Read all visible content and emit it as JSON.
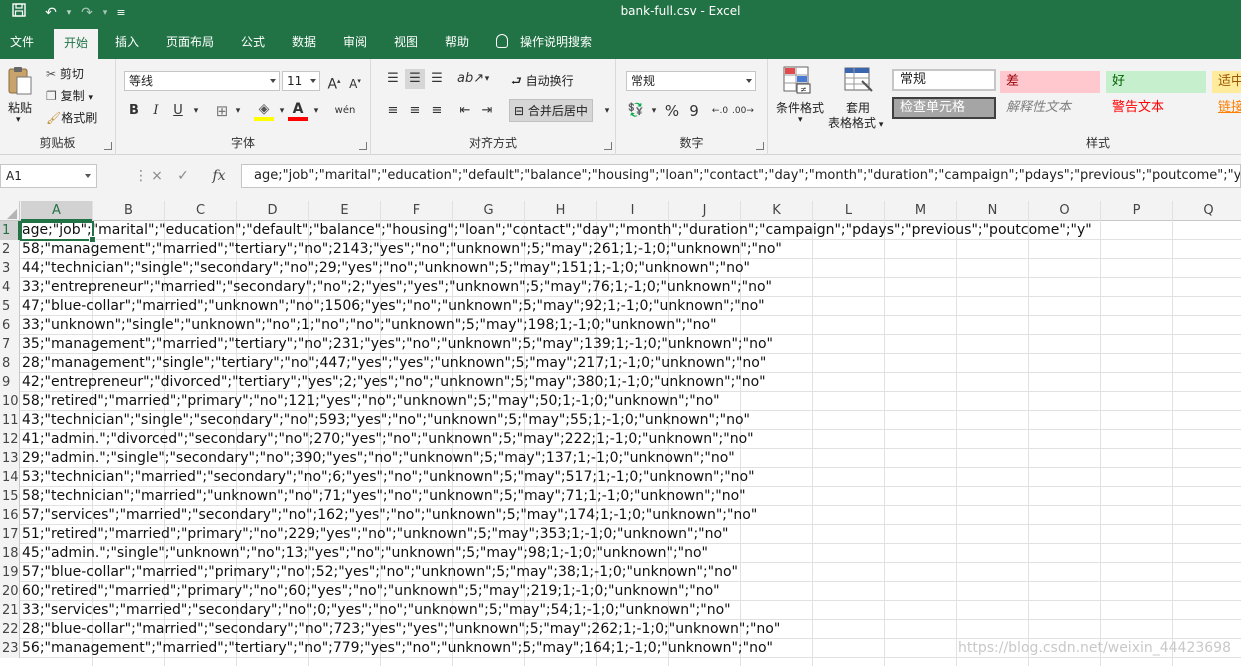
{
  "window": {
    "title": "bank-full.csv  -  Excel"
  },
  "quick_access": {
    "save_icon": "save-icon",
    "undo_icon": "undo-icon",
    "redo_icon": "redo-icon",
    "customize_icon": "customize-icon"
  },
  "tabs": [
    "文件",
    "开始",
    "插入",
    "页面布局",
    "公式",
    "数据",
    "审阅",
    "视图",
    "帮助"
  ],
  "tell_me": "操作说明搜索",
  "ribbon": {
    "clipboard": {
      "label": "剪贴板",
      "paste": "粘贴",
      "cut": "剪切",
      "copy": "复制",
      "format_painter": "格式刷"
    },
    "font": {
      "label": "字体",
      "font_name": "等线",
      "font_size": "11",
      "bold": "B",
      "italic": "I",
      "underline": "U",
      "phonetic": "wén"
    },
    "alignment": {
      "label": "对齐方式",
      "wrap": "自动换行",
      "merge": "合并后居中"
    },
    "number": {
      "label": "数字",
      "format": "常规",
      "percent": "%",
      "comma": "9"
    },
    "styles": {
      "label": "样式",
      "conditional": "条件格式",
      "table_format_1": "套用",
      "table_format_2": "表格格式",
      "cells": [
        {
          "name": "常规",
          "bg": "#ffffff",
          "fg": "#222222"
        },
        {
          "name": "差",
          "bg": "#ffc7ce",
          "fg": "#9c0006"
        },
        {
          "name": "好",
          "bg": "#c6efce",
          "fg": "#006100"
        },
        {
          "name": "适中",
          "bg": "#ffeb9c",
          "fg": "#9c5700"
        },
        {
          "name": "检查单元格",
          "bg": "#a5a5a5",
          "fg": "#ffffff"
        },
        {
          "name": "解释性文本",
          "bg": "#f3f3f3",
          "fg": "#7f7f7f"
        },
        {
          "name": "警告文本",
          "bg": "#f3f3f3",
          "fg": "#ff0000"
        },
        {
          "name": "链接",
          "bg": "#f3f3f3",
          "fg": "#ff7f00"
        }
      ]
    }
  },
  "formula_bar": {
    "name_box": "A1",
    "cancel_icon": "×",
    "enter_icon": "✓",
    "fx": "fx",
    "content": "age;\"job\";\"marital\";\"education\";\"default\";\"balance\";\"housing\";\"loan\";\"contact\";\"day\";\"month\";\"duration\";\"campaign\";\"pdays\";\"previous\";\"poutcome\";\"y\""
  },
  "grid": {
    "columns": [
      "A",
      "B",
      "C",
      "D",
      "E",
      "F",
      "G",
      "H",
      "I",
      "J",
      "K",
      "L",
      "M",
      "N",
      "O",
      "P",
      "Q"
    ],
    "selected_column": "A",
    "rows": [
      {
        "n": "1",
        "text": "age;\"job\";\"marital\";\"education\";\"default\";\"balance\";\"housing\";\"loan\";\"contact\";\"day\";\"month\";\"duration\";\"campaign\";\"pdays\";\"previous\";\"poutcome\";\"y\""
      },
      {
        "n": "2",
        "text": "58;\"management\";\"married\";\"tertiary\";\"no\";2143;\"yes\";\"no\";\"unknown\";5;\"may\";261;1;-1;0;\"unknown\";\"no\""
      },
      {
        "n": "3",
        "text": "44;\"technician\";\"single\";\"secondary\";\"no\";29;\"yes\";\"no\";\"unknown\";5;\"may\";151;1;-1;0;\"unknown\";\"no\""
      },
      {
        "n": "4",
        "text": "33;\"entrepreneur\";\"married\";\"secondary\";\"no\";2;\"yes\";\"yes\";\"unknown\";5;\"may\";76;1;-1;0;\"unknown\";\"no\""
      },
      {
        "n": "5",
        "text": "47;\"blue-collar\";\"married\";\"unknown\";\"no\";1506;\"yes\";\"no\";\"unknown\";5;\"may\";92;1;-1;0;\"unknown\";\"no\""
      },
      {
        "n": "6",
        "text": "33;\"unknown\";\"single\";\"unknown\";\"no\";1;\"no\";\"no\";\"unknown\";5;\"may\";198;1;-1;0;\"unknown\";\"no\""
      },
      {
        "n": "7",
        "text": "35;\"management\";\"married\";\"tertiary\";\"no\";231;\"yes\";\"no\";\"unknown\";5;\"may\";139;1;-1;0;\"unknown\";\"no\""
      },
      {
        "n": "8",
        "text": "28;\"management\";\"single\";\"tertiary\";\"no\";447;\"yes\";\"yes\";\"unknown\";5;\"may\";217;1;-1;0;\"unknown\";\"no\""
      },
      {
        "n": "9",
        "text": "42;\"entrepreneur\";\"divorced\";\"tertiary\";\"yes\";2;\"yes\";\"no\";\"unknown\";5;\"may\";380;1;-1;0;\"unknown\";\"no\""
      },
      {
        "n": "10",
        "text": "58;\"retired\";\"married\";\"primary\";\"no\";121;\"yes\";\"no\";\"unknown\";5;\"may\";50;1;-1;0;\"unknown\";\"no\""
      },
      {
        "n": "11",
        "text": "43;\"technician\";\"single\";\"secondary\";\"no\";593;\"yes\";\"no\";\"unknown\";5;\"may\";55;1;-1;0;\"unknown\";\"no\""
      },
      {
        "n": "12",
        "text": "41;\"admin.\";\"divorced\";\"secondary\";\"no\";270;\"yes\";\"no\";\"unknown\";5;\"may\";222;1;-1;0;\"unknown\";\"no\""
      },
      {
        "n": "13",
        "text": "29;\"admin.\";\"single\";\"secondary\";\"no\";390;\"yes\";\"no\";\"unknown\";5;\"may\";137;1;-1;0;\"unknown\";\"no\""
      },
      {
        "n": "14",
        "text": "53;\"technician\";\"married\";\"secondary\";\"no\";6;\"yes\";\"no\";\"unknown\";5;\"may\";517;1;-1;0;\"unknown\";\"no\""
      },
      {
        "n": "15",
        "text": "58;\"technician\";\"married\";\"unknown\";\"no\";71;\"yes\";\"no\";\"unknown\";5;\"may\";71;1;-1;0;\"unknown\";\"no\""
      },
      {
        "n": "16",
        "text": "57;\"services\";\"married\";\"secondary\";\"no\";162;\"yes\";\"no\";\"unknown\";5;\"may\";174;1;-1;0;\"unknown\";\"no\""
      },
      {
        "n": "17",
        "text": "51;\"retired\";\"married\";\"primary\";\"no\";229;\"yes\";\"no\";\"unknown\";5;\"may\";353;1;-1;0;\"unknown\";\"no\""
      },
      {
        "n": "18",
        "text": "45;\"admin.\";\"single\";\"unknown\";\"no\";13;\"yes\";\"no\";\"unknown\";5;\"may\";98;1;-1;0;\"unknown\";\"no\""
      },
      {
        "n": "19",
        "text": "57;\"blue-collar\";\"married\";\"primary\";\"no\";52;\"yes\";\"no\";\"unknown\";5;\"may\";38;1;-1;0;\"unknown\";\"no\""
      },
      {
        "n": "20",
        "text": "60;\"retired\";\"married\";\"primary\";\"no\";60;\"yes\";\"no\";\"unknown\";5;\"may\";219;1;-1;0;\"unknown\";\"no\""
      },
      {
        "n": "21",
        "text": "33;\"services\";\"married\";\"secondary\";\"no\";0;\"yes\";\"no\";\"unknown\";5;\"may\";54;1;-1;0;\"unknown\";\"no\""
      },
      {
        "n": "22",
        "text": "28;\"blue-collar\";\"married\";\"secondary\";\"no\";723;\"yes\";\"yes\";\"unknown\";5;\"may\";262;1;-1;0;\"unknown\";\"no\""
      },
      {
        "n": "23",
        "text": "56;\"management\";\"married\";\"tertiary\";\"no\";779;\"yes\";\"no\";\"unknown\";5;\"may\";164;1;-1;0;\"unknown\";\"no\""
      }
    ]
  },
  "watermark": "https://blog.csdn.net/weixin_44423698"
}
